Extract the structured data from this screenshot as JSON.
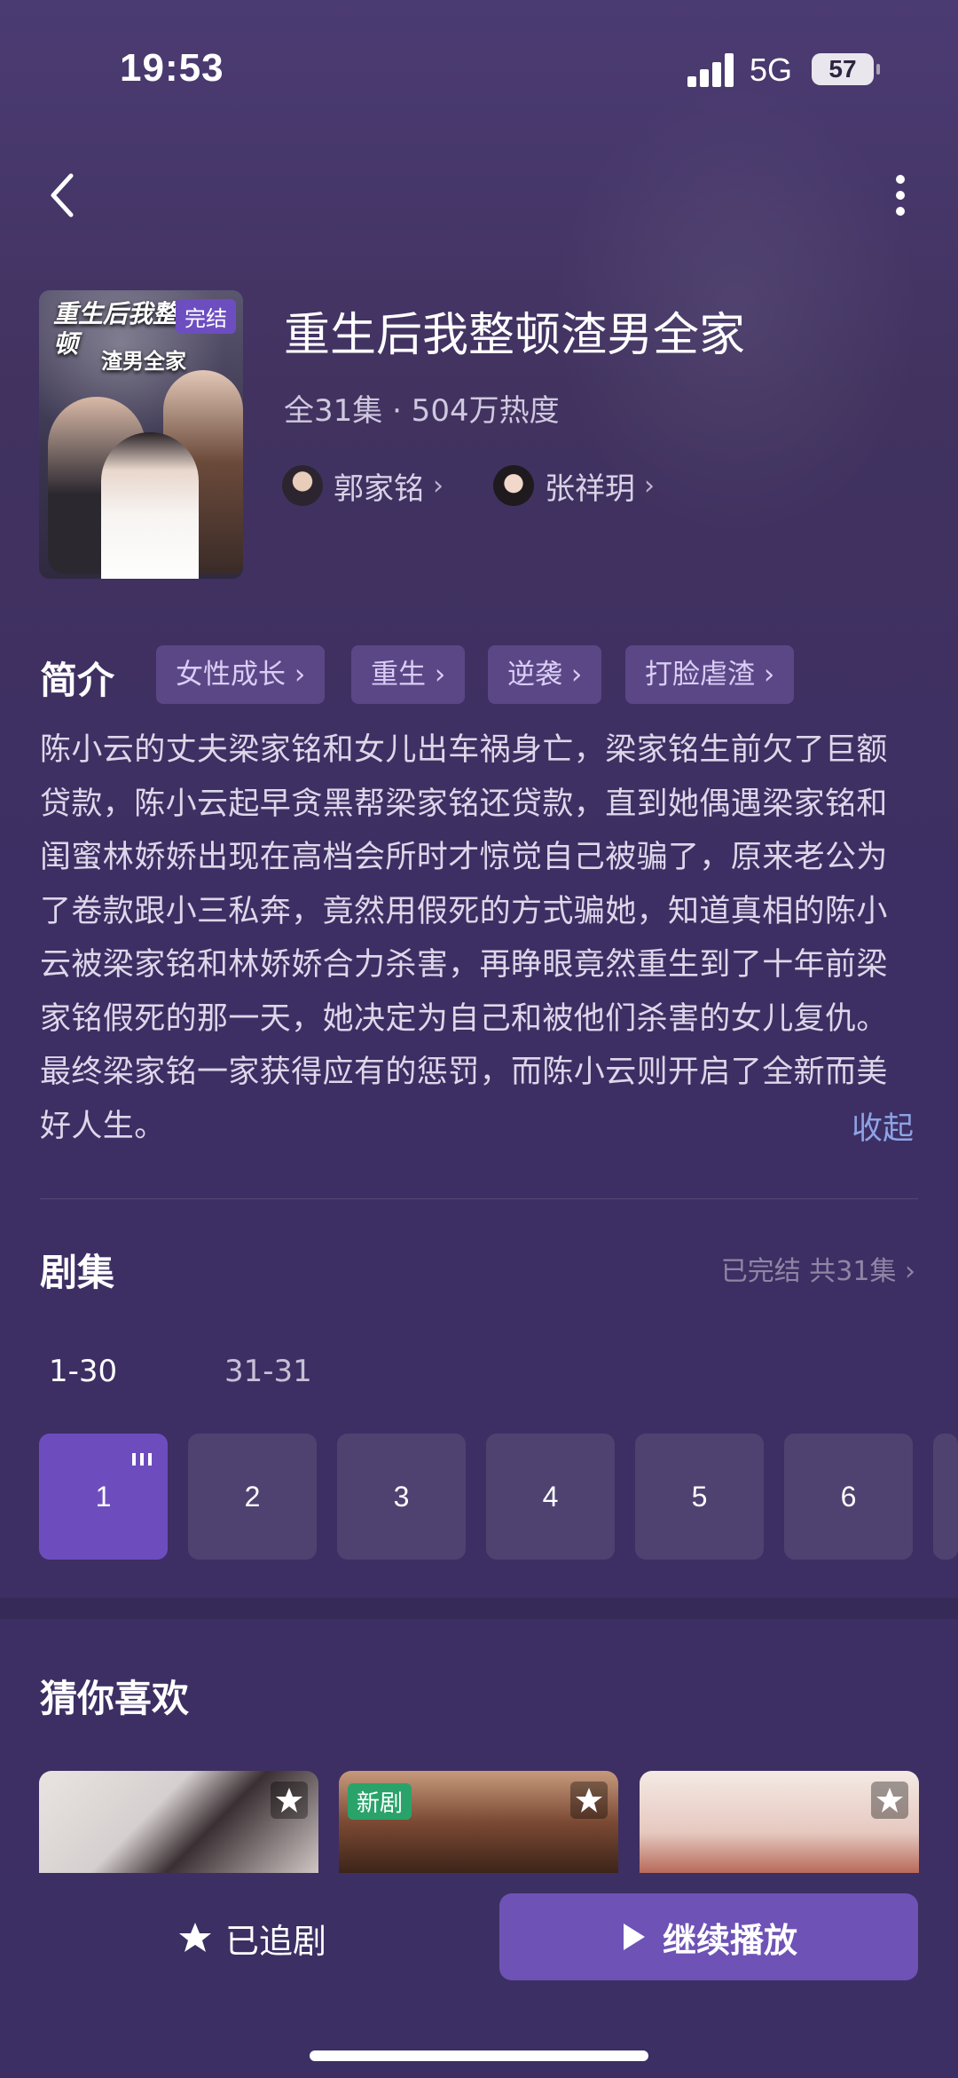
{
  "status_bar": {
    "time": "19:53",
    "network": "5G",
    "battery": "57"
  },
  "drama": {
    "title": "重生后我整顿渣男全家",
    "meta": "全31集 · 504万热度",
    "cover_title_line1": "重生后我整顿",
    "cover_title_line2": "渣男全家",
    "cover_badge": "完结",
    "actors": [
      {
        "name": "郭家铭"
      },
      {
        "name": "张祥玥"
      }
    ]
  },
  "intro": {
    "label": "简介",
    "tags": [
      "女性成长 ›",
      "重生 ›",
      "逆袭 ›",
      "打脸虐渣 ›"
    ],
    "description": "陈小云的丈夫梁家铭和女儿出车祸身亡，梁家铭生前欠了巨额贷款，陈小云起早贪黑帮梁家铭还贷款，直到她偶遇梁家铭和闺蜜林娇娇出现在高档会所时才惊觉自己被骗了，原来老公为了卷款跟小三私奔，竟然用假死的方式骗她，知道真相的陈小云被梁家铭和林娇娇合力杀害，再睁眼竟然重生到了十年前梁家铭假死的那一天，她决定为自己和被他们杀害的女儿复仇。最终梁家铭一家获得应有的惩罚，而陈小云则开启了全新而美好人生。",
    "collapse_label": "收起"
  },
  "episodes": {
    "label": "剧集",
    "status": "已完结 共31集 ›",
    "ranges": [
      "1-30",
      "31-31"
    ],
    "items": [
      "1",
      "2",
      "3",
      "4",
      "5",
      "6"
    ],
    "current": "1"
  },
  "recommend": {
    "label": "猜你喜欢",
    "new_badge": "新剧"
  },
  "bottom": {
    "follow_label": "已追剧",
    "play_label": "继续播放"
  },
  "colors": {
    "background": "#3d2f63",
    "accent": "#6d4dbe",
    "tag_bg": "#5b4786",
    "link": "#8ea3e6"
  }
}
